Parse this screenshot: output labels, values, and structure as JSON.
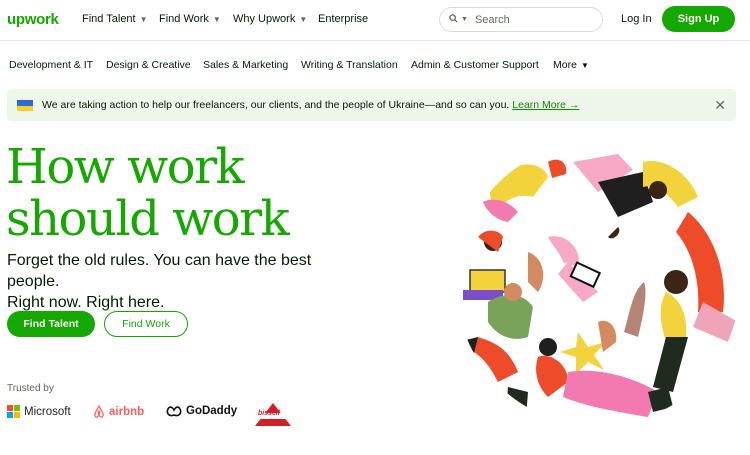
{
  "brand_logo": "upwork",
  "nav": {
    "find_talent": "Find Talent",
    "find_work": "Find Work",
    "why_upwork": "Why Upwork",
    "enterprise": "Enterprise"
  },
  "search": {
    "placeholder": "Search"
  },
  "login": "Log In",
  "signup": "Sign Up",
  "categories": [
    "Development & IT",
    "Design & Creative",
    "Sales & Marketing",
    "Writing & Translation",
    "Admin & Customer Support",
    "More"
  ],
  "banner": {
    "text": "We are taking action to help our freelancers, our clients, and the people of Ukraine—and so can you.",
    "link": "Learn More →"
  },
  "hero": {
    "title_line1": "How work",
    "title_line2": "should work",
    "subtitle_line1": "Forget the old rules. You can have the best people.",
    "subtitle_line2": "Right now. Right here.",
    "find_talent_btn": "Find Talent",
    "find_work_btn": "Find Work"
  },
  "trusted": {
    "label": "Trusted by",
    "brands": [
      "Microsoft",
      "airbnb",
      "GoDaddy",
      "bissell"
    ]
  },
  "colors": {
    "brand_green": "#14a800",
    "banner_bg": "#eef6ec",
    "text_dark": "#001e00"
  },
  "icons": [
    "search-icon",
    "chevron-down-icon",
    "close-icon",
    "ukraine-flag-icon"
  ]
}
